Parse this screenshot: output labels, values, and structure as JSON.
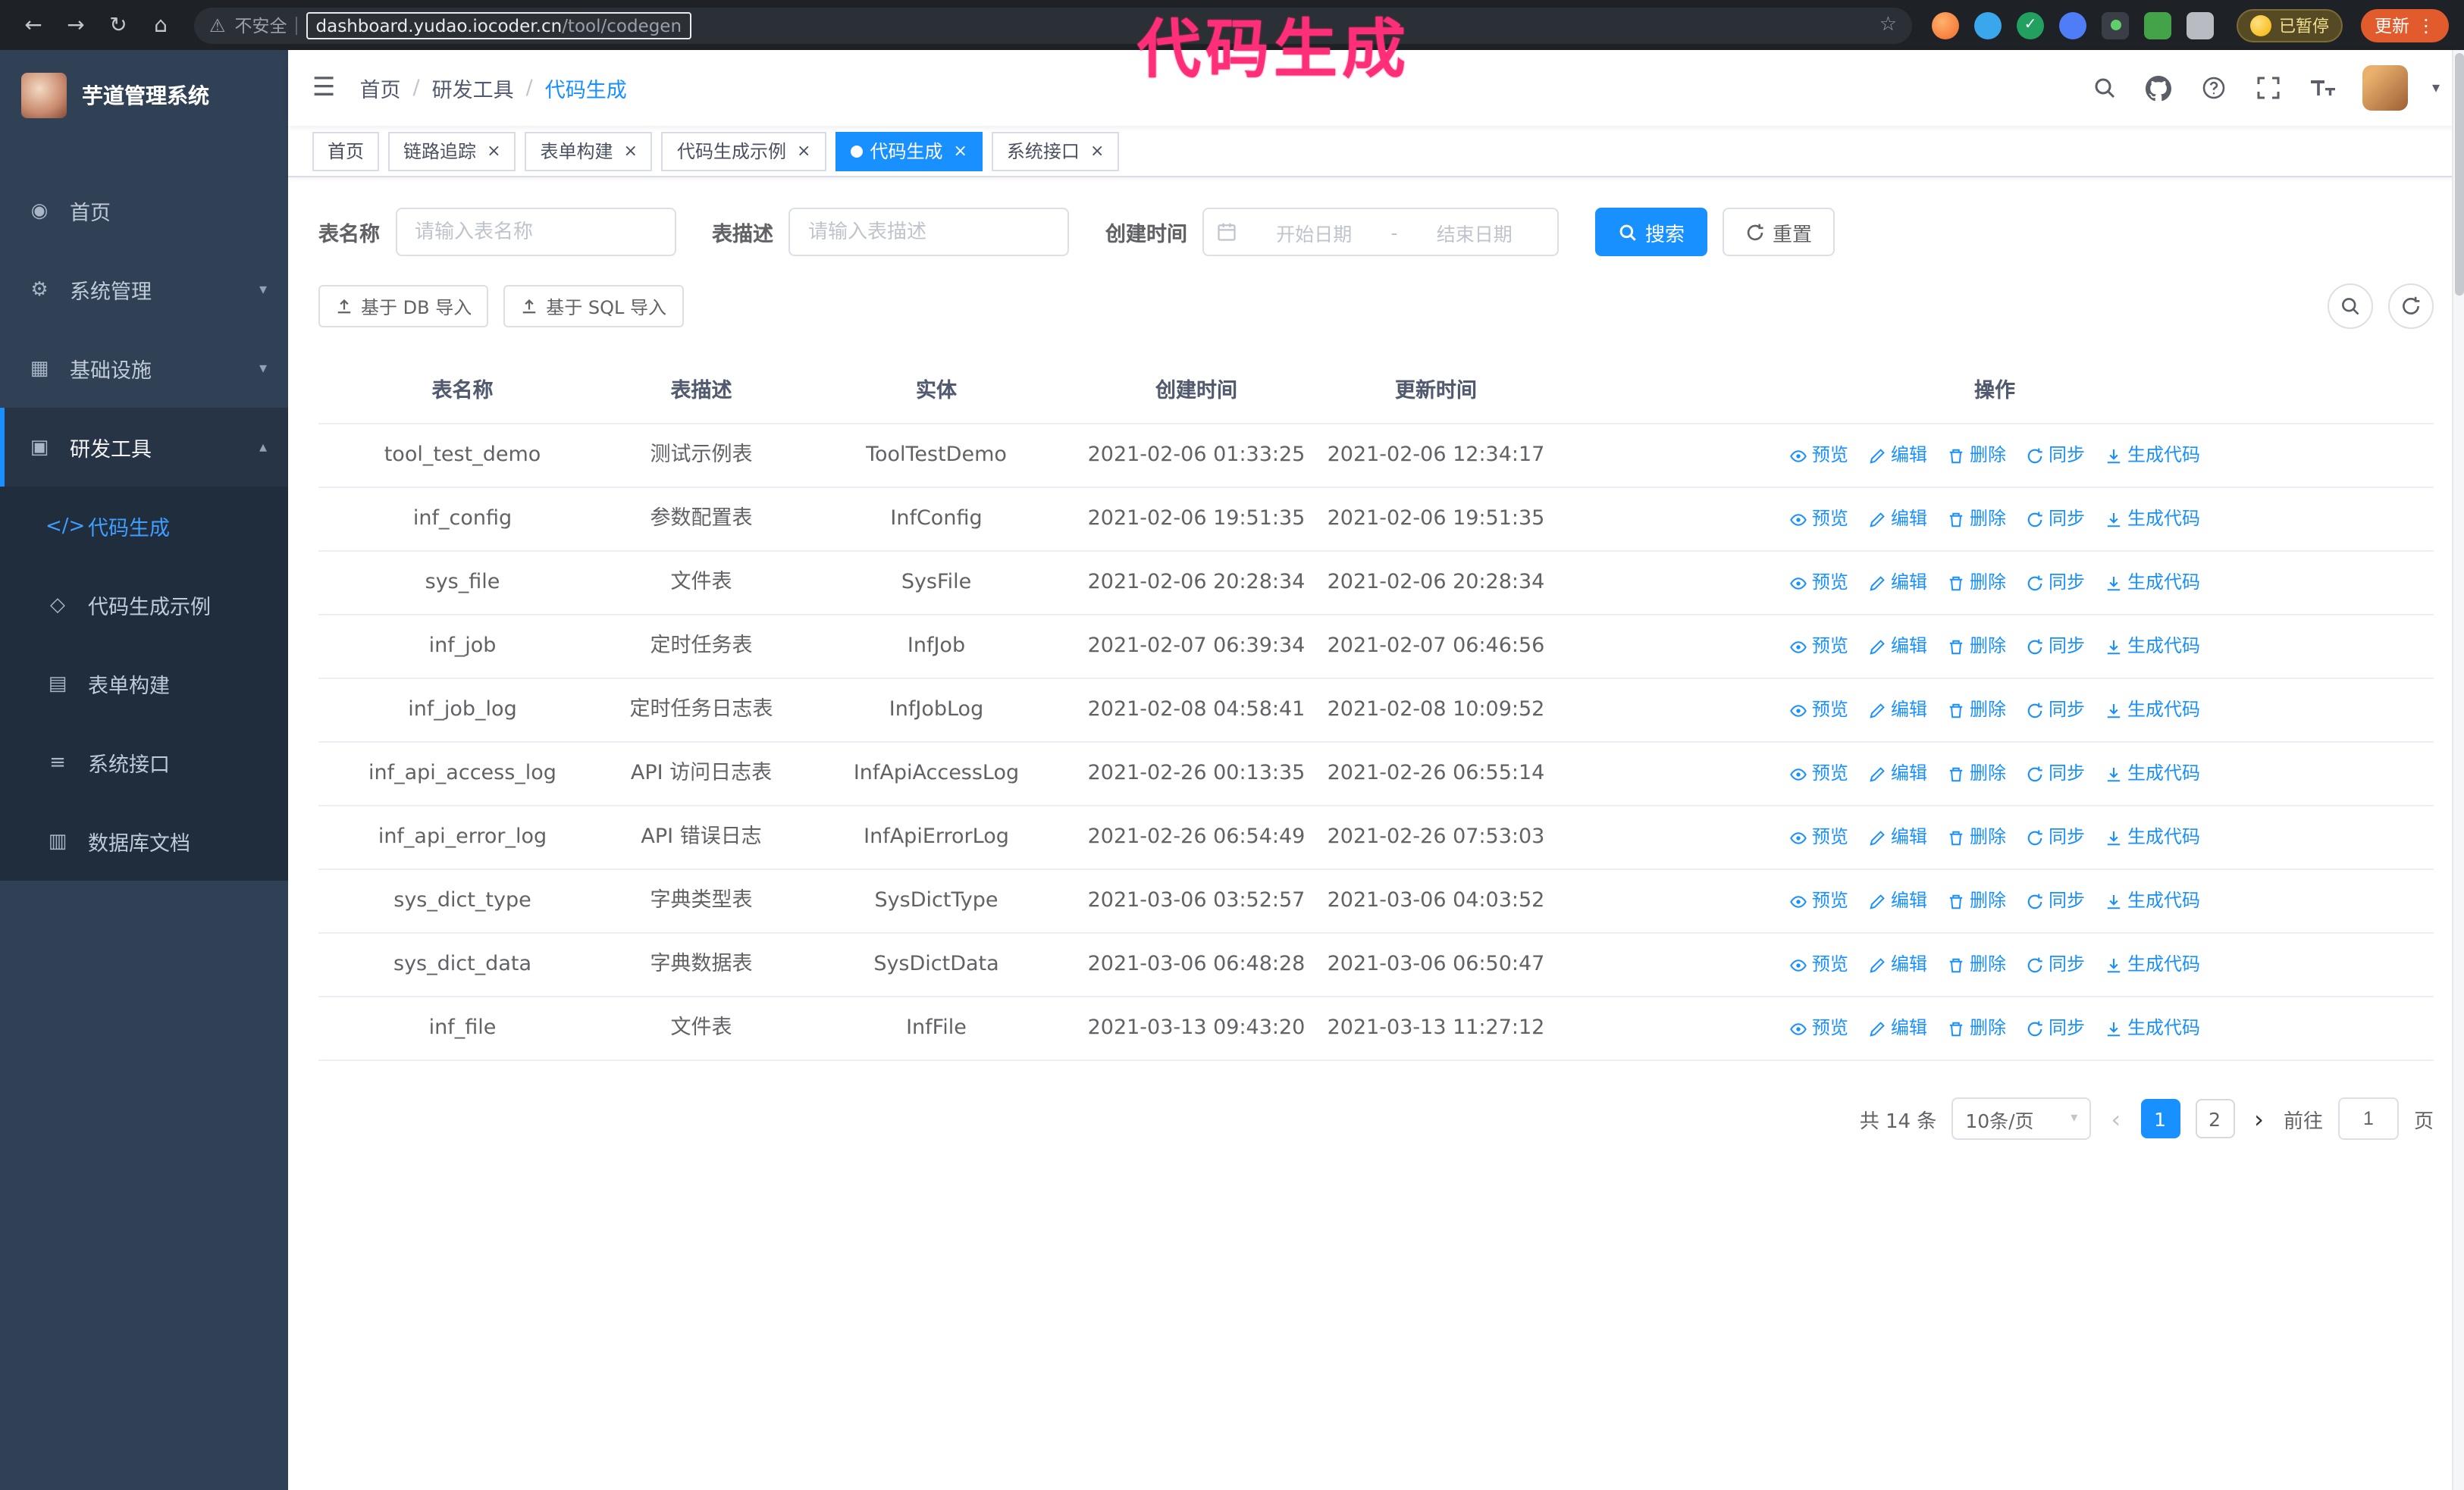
{
  "browser": {
    "security_label": "不安全",
    "url_host": "dashboard.yudao.iocoder.cn",
    "url_path": "/tool/codegen",
    "paused_badge": "已暂停",
    "update_button": "更新"
  },
  "annotation": {
    "text": "代码生成",
    "color": "#ff2e78"
  },
  "icons": {
    "back": "←",
    "forward": "→",
    "reload": "↻",
    "home_nav": "⌂",
    "warning": "⚠",
    "star": "☆",
    "kebab": "⋮",
    "hamburger": "☰",
    "caret_down": "▾",
    "caret_up": "▴",
    "home": "◉",
    "gear": "⚙",
    "infra": "▦",
    "tools": "▣",
    "code": "</>",
    "example": "◇",
    "form": "▤",
    "api": "≡",
    "dbdoc": "▥",
    "prev": "‹",
    "next": "›"
  },
  "colors": {
    "primary": "#1890ff",
    "sidebar_bg": "#304156",
    "submenu_bg": "#1f2d3d",
    "annotation": "#ff2e78"
  },
  "sidebar": {
    "logo_title": "芋道管理系统",
    "items": [
      {
        "label": "首页"
      },
      {
        "label": "系统管理"
      },
      {
        "label": "基础设施"
      },
      {
        "label": "研发工具"
      }
    ],
    "subitems": [
      {
        "label": "代码生成"
      },
      {
        "label": "代码生成示例"
      },
      {
        "label": "表单构建"
      },
      {
        "label": "系统接口"
      },
      {
        "label": "数据库文档"
      }
    ]
  },
  "navbar": {
    "breadcrumb": [
      "首页",
      "研发工具",
      "代码生成"
    ]
  },
  "tabs": [
    {
      "label": "首页"
    },
    {
      "label": "链路追踪"
    },
    {
      "label": "表单构建"
    },
    {
      "label": "代码生成示例"
    },
    {
      "label": "代码生成"
    },
    {
      "label": "系统接口"
    }
  ],
  "filters": {
    "name_label": "表名称",
    "name_placeholder": "请输入表名称",
    "desc_label": "表描述",
    "desc_placeholder": "请输入表描述",
    "time_label": "创建时间",
    "start_placeholder": "开始日期",
    "range_separator": "-",
    "end_placeholder": "结束日期",
    "search_label": "搜索",
    "reset_label": "重置"
  },
  "toolbar": {
    "import_db": "基于 DB 导入",
    "import_sql": "基于 SQL 导入"
  },
  "table": {
    "headers": [
      "表名称",
      "表描述",
      "实体",
      "创建时间",
      "更新时间",
      "操作"
    ],
    "actions": [
      "预览",
      "编辑",
      "删除",
      "同步",
      "生成代码"
    ],
    "rows": [
      {
        "name": "tool_test_demo",
        "desc": "测试示例表",
        "entity": "ToolTestDemo",
        "created": "2021-02-06 01:33:25",
        "updated": "2021-02-06 12:34:17"
      },
      {
        "name": "inf_config",
        "desc": "参数配置表",
        "entity": "InfConfig",
        "created": "2021-02-06 19:51:35",
        "updated": "2021-02-06 19:51:35"
      },
      {
        "name": "sys_file",
        "desc": "文件表",
        "entity": "SysFile",
        "created": "2021-02-06 20:28:34",
        "updated": "2021-02-06 20:28:34"
      },
      {
        "name": "inf_job",
        "desc": "定时任务表",
        "entity": "InfJob",
        "created": "2021-02-07 06:39:34",
        "updated": "2021-02-07 06:46:56"
      },
      {
        "name": "inf_job_log",
        "desc": "定时任务日志表",
        "entity": "InfJobLog",
        "created": "2021-02-08 04:58:41",
        "updated": "2021-02-08 10:09:52"
      },
      {
        "name": "inf_api_access_log",
        "desc": "API 访问日志表",
        "entity": "InfApiAccessLog",
        "created": "2021-02-26 00:13:35",
        "updated": "2021-02-26 06:55:14"
      },
      {
        "name": "inf_api_error_log",
        "desc": "API 错误日志",
        "entity": "InfApiErrorLog",
        "created": "2021-02-26 06:54:49",
        "updated": "2021-02-26 07:53:03"
      },
      {
        "name": "sys_dict_type",
        "desc": "字典类型表",
        "entity": "SysDictType",
        "created": "2021-03-06 03:52:57",
        "updated": "2021-03-06 04:03:52"
      },
      {
        "name": "sys_dict_data",
        "desc": "字典数据表",
        "entity": "SysDictData",
        "created": "2021-03-06 06:48:28",
        "updated": "2021-03-06 06:50:47"
      },
      {
        "name": "inf_file",
        "desc": "文件表",
        "entity": "InfFile",
        "created": "2021-03-13 09:43:20",
        "updated": "2021-03-13 11:27:12"
      }
    ]
  },
  "pagination": {
    "total": "共 14 条",
    "page_size": "10条/页",
    "pages": [
      "1",
      "2"
    ],
    "goto_label": "前往",
    "goto_value": "1",
    "goto_suffix": "页"
  }
}
